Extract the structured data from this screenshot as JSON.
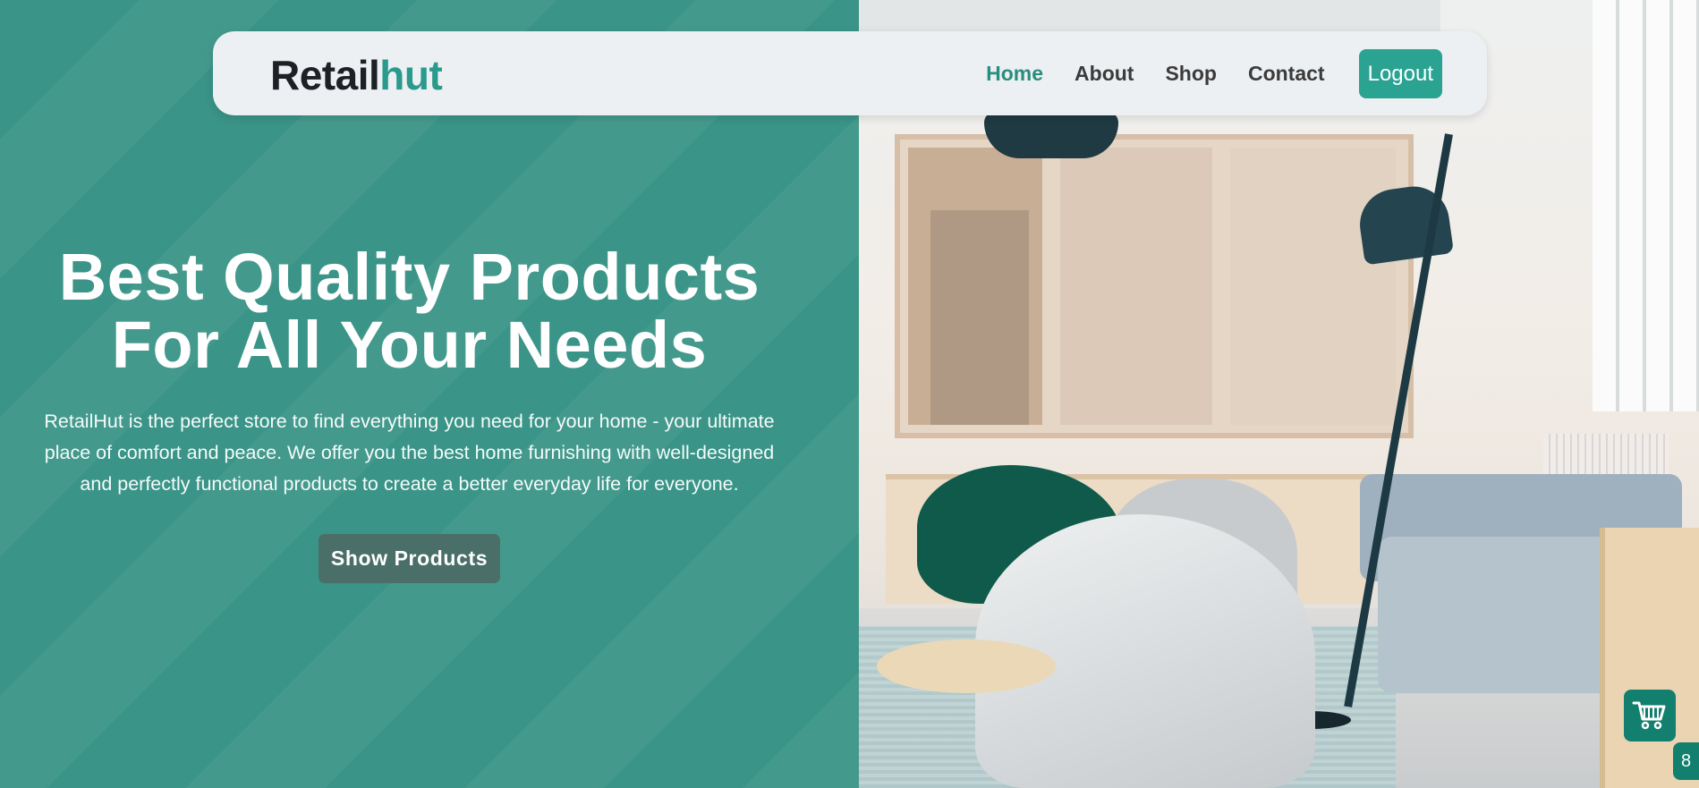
{
  "brand": {
    "part1": "Retail",
    "part2": "hut"
  },
  "nav": {
    "links": [
      {
        "label": "Home",
        "active": true
      },
      {
        "label": "About"
      },
      {
        "label": "Shop"
      },
      {
        "label": "Contact"
      }
    ],
    "logout_label": "Logout"
  },
  "hero": {
    "title_line1": "Best Quality Products",
    "title_line2": "For All Your Needs",
    "description": "RetailHut is the perfect store to find everything you need for your home - your ultimate place of comfort and peace. We offer you the best home furnishing with well-designed and perfectly functional products to create a better everyday life for everyone.",
    "button_label": "Show Products"
  },
  "cart": {
    "icon": "shopping-cart-icon",
    "count": "8"
  },
  "colors": {
    "primary": "#3a9487",
    "accent": "#2aa393",
    "nav_bg": "#edf0f3",
    "cart": "#137f6f"
  }
}
